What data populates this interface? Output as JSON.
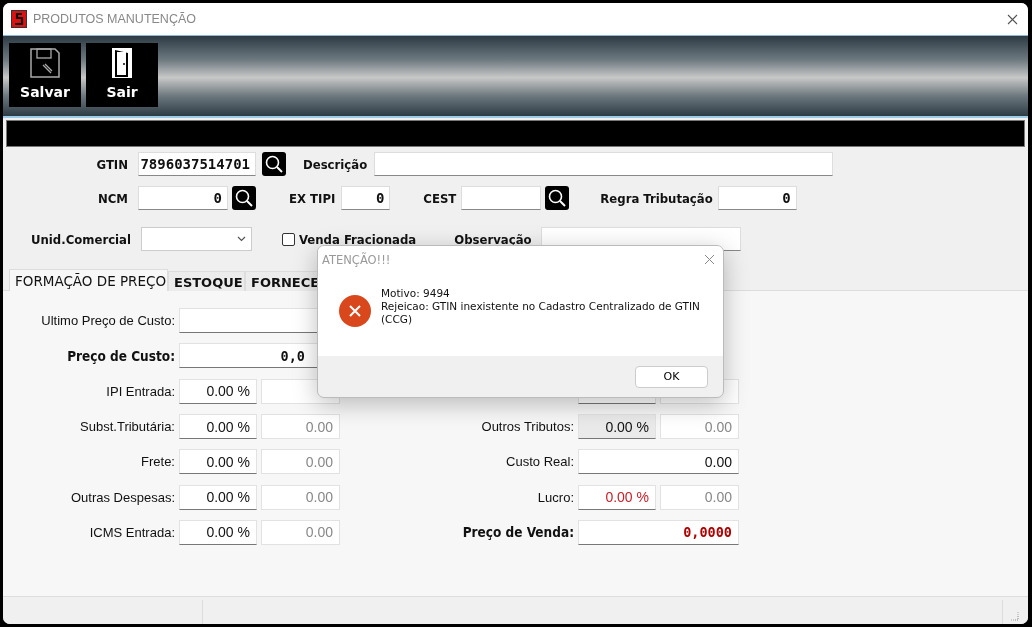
{
  "window": {
    "title": "PRODUTOS MANUTENÇÃO"
  },
  "toolbar": [
    {
      "kind": "save",
      "label": "Salvar"
    },
    {
      "kind": "exit",
      "label": "Sair"
    }
  ],
  "form": {
    "gtin": {
      "label": "GTIN",
      "value": "7896037514701"
    },
    "descricao": {
      "label": "Descrição"
    },
    "ncm": {
      "label": "NCM",
      "value": "0"
    },
    "ex_tipi": {
      "label": "EX TIPI",
      "value": "0"
    },
    "cest": {
      "label": "CEST"
    },
    "regra_tributacao": {
      "label": "Regra Tributação",
      "value": "0"
    },
    "unid_comercial": {
      "label": "Unid.Comercial"
    },
    "venda_fracionada": {
      "label": "Venda Fracionada",
      "checked": false
    },
    "observacao": {
      "label": "Observação"
    }
  },
  "tabs": [
    {
      "label": "FORMAÇÃO DE PREÇO",
      "selected": true
    },
    {
      "label": "ESTOQUE",
      "selected": false
    },
    {
      "label": "FORNECE",
      "selected": false
    }
  ],
  "price_left": [
    {
      "kind": "single",
      "label": "Ultimo Preço de Custo:",
      "bold": false,
      "disabled": false
    },
    {
      "kind": "single",
      "label": "Preço de Custo:",
      "value": "0,0",
      "bold": true,
      "disabled": false
    },
    {
      "kind": "pair",
      "label": "IPI Entrada:",
      "percent": "0.00 %",
      "bold": false,
      "disabled": false
    },
    {
      "kind": "pair",
      "label": "Subst.Tributária:",
      "percent": "0.00 %",
      "value": "0.00",
      "bold": false,
      "disabled": false
    },
    {
      "kind": "pair",
      "label": "Frete:",
      "percent": "0.00 %",
      "value": "0.00",
      "bold": false,
      "disabled": false
    },
    {
      "kind": "pair",
      "label": "Outras Despesas:",
      "percent": "0.00 %",
      "value": "0.00",
      "bold": false,
      "disabled": false
    },
    {
      "kind": "pair",
      "label": "ICMS Entrada:",
      "percent": "0.00 %",
      "value": "0.00",
      "bold": false,
      "disabled": false
    }
  ],
  "price_right": [
    {
      "kind": "pair",
      "disabled": false
    },
    {
      "kind": "pair",
      "label": "Outros Tributos:",
      "percent": "0.00 %",
      "value": "0.00",
      "bold": false,
      "disabled": true
    },
    {
      "kind": "single",
      "label": "Custo Real:",
      "value": "0.00",
      "bold": false,
      "disabled": false
    },
    {
      "kind": "pair",
      "label": "Lucro:",
      "percent": "0.00 %",
      "value": "0.00",
      "bold": false,
      "disabled": false,
      "color": "#c8202a"
    },
    {
      "kind": "single",
      "label": "Preço de Venda:",
      "value": "0,0000",
      "bold": true,
      "disabled": false,
      "color": "#b00000"
    }
  ],
  "dialog": {
    "title": "ATENÇÃO!!!",
    "lines": [
      "Motivo: 9494",
      "Rejeicao: GTIN inexistente no Cadastro Centralizado de GTIN (CCG)"
    ],
    "button": "OK"
  }
}
